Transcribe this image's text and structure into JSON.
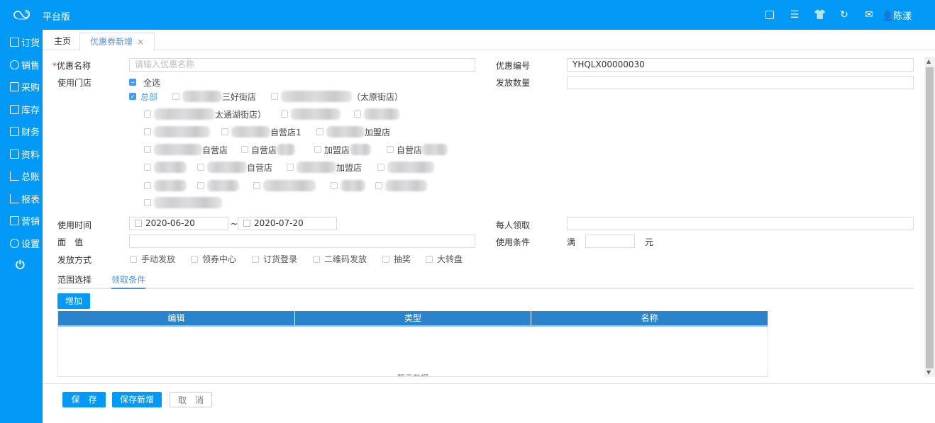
{
  "header": {
    "brand": "平台版",
    "user": "陈漾",
    "icons": [
      "screen-icon",
      "menu-icon",
      "shirt-icon",
      "refresh-icon",
      "mail-icon",
      "user-icon"
    ]
  },
  "sidebar": {
    "items": [
      {
        "label": "订货",
        "icon": "clipboard-icon"
      },
      {
        "label": "销售",
        "icon": "person-icon"
      },
      {
        "label": "采购",
        "icon": "cart-icon"
      },
      {
        "label": "库存",
        "icon": "box-icon"
      },
      {
        "label": "财务",
        "icon": "lock-bag-icon"
      },
      {
        "label": "资料",
        "icon": "contact-icon"
      },
      {
        "label": "总账",
        "icon": "chart-icon"
      },
      {
        "label": "报表",
        "icon": "chart-icon"
      },
      {
        "label": "营销",
        "icon": "monitor-icon"
      },
      {
        "label": "设置",
        "icon": "gear-icon"
      }
    ],
    "power_icon": "power-icon"
  },
  "tabs": [
    {
      "label": "主页"
    },
    {
      "label": "优惠券新增",
      "close": "×"
    }
  ],
  "form": {
    "name_label": "优惠名称",
    "required_mark": "*",
    "name_placeholder": "请输入优惠名称",
    "code_label": "优惠编号",
    "code_value": "YHQLX00000030",
    "stores_label": "使用门店",
    "select_all": "全选",
    "qty_label": "发放数量",
    "qty_value": "",
    "stores": [
      "总部",
      "三好街店",
      "（太原街店）",
      "太通湖街店）",
      "",
      "",
      "",
      "自营店1",
      "加盟店",
      "自营店",
      "自营店",
      "加盟店",
      "自营店",
      "",
      "自营店",
      "加盟店",
      "",
      "",
      "",
      "",
      "",
      "",
      ""
    ],
    "time_label": "使用时间",
    "date_from": "2020-06-20",
    "date_sep": "~",
    "date_to": "2020-07-20",
    "per_person_label": "每人领取",
    "per_person_value": "",
    "face_label": "面　值",
    "face_value": "",
    "condition_label": "使用条件",
    "condition_prefix": "满",
    "condition_value": "",
    "condition_suffix": "元",
    "method_label": "发放方式",
    "methods": [
      "手动发放",
      "领券中心",
      "订货登录",
      "二维码发放",
      "抽奖",
      "大转盘"
    ]
  },
  "subtabs": [
    {
      "label": "范围选择"
    },
    {
      "label": "领取条件",
      "active": true
    }
  ],
  "add_button": "增加",
  "grid": {
    "columns": [
      "编辑",
      "类型",
      "名称"
    ],
    "empty": "暂无数据"
  },
  "footer": {
    "save": "保　存",
    "save_new": "保存新增",
    "cancel": "取　消"
  }
}
